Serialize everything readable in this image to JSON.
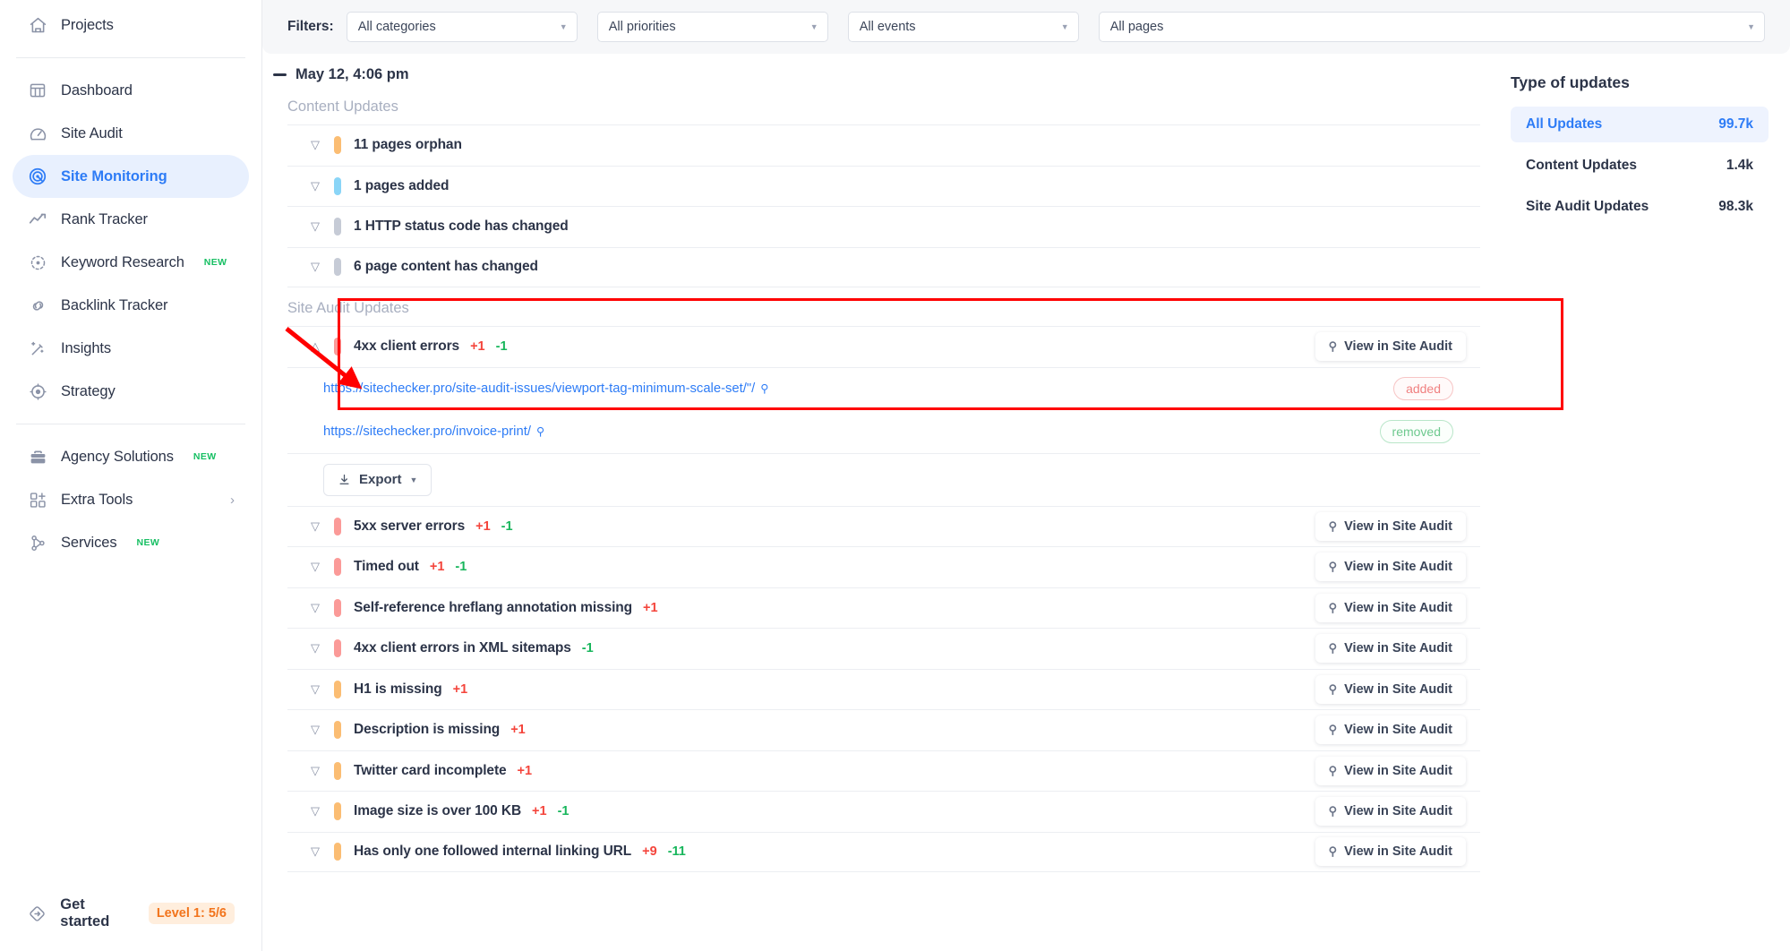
{
  "sidebar": {
    "top_items": [
      {
        "label": "Projects",
        "icon": "home-icon",
        "badge": ""
      }
    ],
    "items": [
      {
        "label": "Dashboard",
        "icon": "dashboard-icon",
        "badge": "",
        "active": false
      },
      {
        "label": "Site Audit",
        "icon": "gauge-icon",
        "badge": "",
        "active": false
      },
      {
        "label": "Site Monitoring",
        "icon": "radar-icon",
        "badge": "",
        "active": true
      },
      {
        "label": "Rank Tracker",
        "icon": "trend-line-icon",
        "badge": "",
        "active": false
      },
      {
        "label": "Keyword Research",
        "icon": "target-icon",
        "badge": "NEW",
        "active": false
      },
      {
        "label": "Backlink Tracker",
        "icon": "link-icon",
        "badge": "",
        "active": false
      },
      {
        "label": "Insights",
        "icon": "magic-wand-icon",
        "badge": "",
        "active": false
      },
      {
        "label": "Strategy",
        "icon": "crosshair-icon",
        "badge": "",
        "active": false
      }
    ],
    "secondary_items": [
      {
        "label": "Agency Solutions",
        "icon": "briefcase-icon",
        "badge": "NEW",
        "chevron": false
      },
      {
        "label": "Extra Tools",
        "icon": "grid-plus-icon",
        "badge": "",
        "chevron": true
      },
      {
        "label": "Services",
        "icon": "nodes-icon",
        "badge": "NEW",
        "chevron": false
      }
    ],
    "get_started": {
      "label": "Get started",
      "icon": "rocket-diamond-icon",
      "level_pill": "Level 1: 5/6"
    }
  },
  "filters": {
    "label": "Filters:",
    "selects": [
      {
        "name": "categories",
        "value": "All categories"
      },
      {
        "name": "priorities",
        "value": "All priorities"
      },
      {
        "name": "events",
        "value": "All events"
      },
      {
        "name": "pages",
        "value": "All pages"
      }
    ]
  },
  "feed": {
    "date_header": "May 12, 4:06 pm",
    "content_section_title": "Content Updates",
    "content_rows": [
      {
        "label": "11 pages orphan",
        "priority": "orange",
        "expanded": false,
        "deltas": []
      },
      {
        "label": "1 pages added",
        "priority": "blue",
        "expanded": false,
        "deltas": []
      },
      {
        "label": "1 HTTP status code has changed",
        "priority": "gray",
        "expanded": false,
        "deltas": []
      },
      {
        "label": "6 page content has changed",
        "priority": "gray",
        "expanded": false,
        "deltas": []
      }
    ],
    "audit_section_title": "Site Audit Updates",
    "highlighted_row": {
      "label": "4xx client errors",
      "priority": "red",
      "expanded": true,
      "deltas": [
        {
          "text": "+1",
          "kind": "pos"
        },
        {
          "text": "-1",
          "kind": "neg"
        }
      ],
      "view_button": "View in Site Audit",
      "details": [
        {
          "url": "https://sitechecker.pro/site-audit-issues/viewport-tag-minimum-scale-set/\"/",
          "status": "added"
        },
        {
          "url": "https://sitechecker.pro/invoice-print/",
          "status": "removed"
        }
      ],
      "export_button": "Export"
    },
    "audit_rows": [
      {
        "label": "5xx server errors",
        "priority": "red",
        "deltas": [
          {
            "text": "+1",
            "kind": "pos"
          },
          {
            "text": "-1",
            "kind": "neg"
          }
        ],
        "view_button": "View in Site Audit"
      },
      {
        "label": "Timed out",
        "priority": "red",
        "deltas": [
          {
            "text": "+1",
            "kind": "pos"
          },
          {
            "text": "-1",
            "kind": "neg"
          }
        ],
        "view_button": "View in Site Audit"
      },
      {
        "label": "Self-reference hreflang annotation missing",
        "priority": "red",
        "deltas": [
          {
            "text": "+1",
            "kind": "pos"
          }
        ],
        "view_button": "View in Site Audit"
      },
      {
        "label": "4xx client errors in XML sitemaps",
        "priority": "red",
        "deltas": [
          {
            "text": "-1",
            "kind": "neg"
          }
        ],
        "view_button": "View in Site Audit"
      },
      {
        "label": "H1 is missing",
        "priority": "orange",
        "deltas": [
          {
            "text": "+1",
            "kind": "pos"
          }
        ],
        "view_button": "View in Site Audit"
      },
      {
        "label": "Description is missing",
        "priority": "orange",
        "deltas": [
          {
            "text": "+1",
            "kind": "pos"
          }
        ],
        "view_button": "View in Site Audit"
      },
      {
        "label": "Twitter card incomplete",
        "priority": "orange",
        "deltas": [
          {
            "text": "+1",
            "kind": "pos"
          }
        ],
        "view_button": "View in Site Audit"
      },
      {
        "label": "Image size is over 100 KB",
        "priority": "orange",
        "deltas": [
          {
            "text": "+1",
            "kind": "pos"
          },
          {
            "text": "-1",
            "kind": "neg"
          }
        ],
        "view_button": "View in Site Audit"
      },
      {
        "label": "Has only one followed internal linking URL",
        "priority": "orange",
        "deltas": [
          {
            "text": "+9",
            "kind": "pos"
          },
          {
            "text": "-11",
            "kind": "neg"
          }
        ],
        "view_button": "View in Site Audit"
      }
    ]
  },
  "side_panel": {
    "title": "Type of updates",
    "items": [
      {
        "label": "All Updates",
        "value": "99.7k",
        "active": true
      },
      {
        "label": "Content Updates",
        "value": "1.4k",
        "active": false
      },
      {
        "label": "Site Audit Updates",
        "value": "98.3k",
        "active": false
      }
    ]
  },
  "annotation": {
    "color": "#ff0000",
    "shape": "arrow-and-box"
  },
  "colors": {
    "accent_blue": "#2e7cf6",
    "priority_red": "#fb9a98",
    "priority_orange": "#fbbd73",
    "priority_blue": "#8ad5f7",
    "priority_gray": "#c6cbd6",
    "delta_positive": "#f4453c",
    "delta_negative": "#18b65c",
    "annotation_red": "#ff0000"
  }
}
